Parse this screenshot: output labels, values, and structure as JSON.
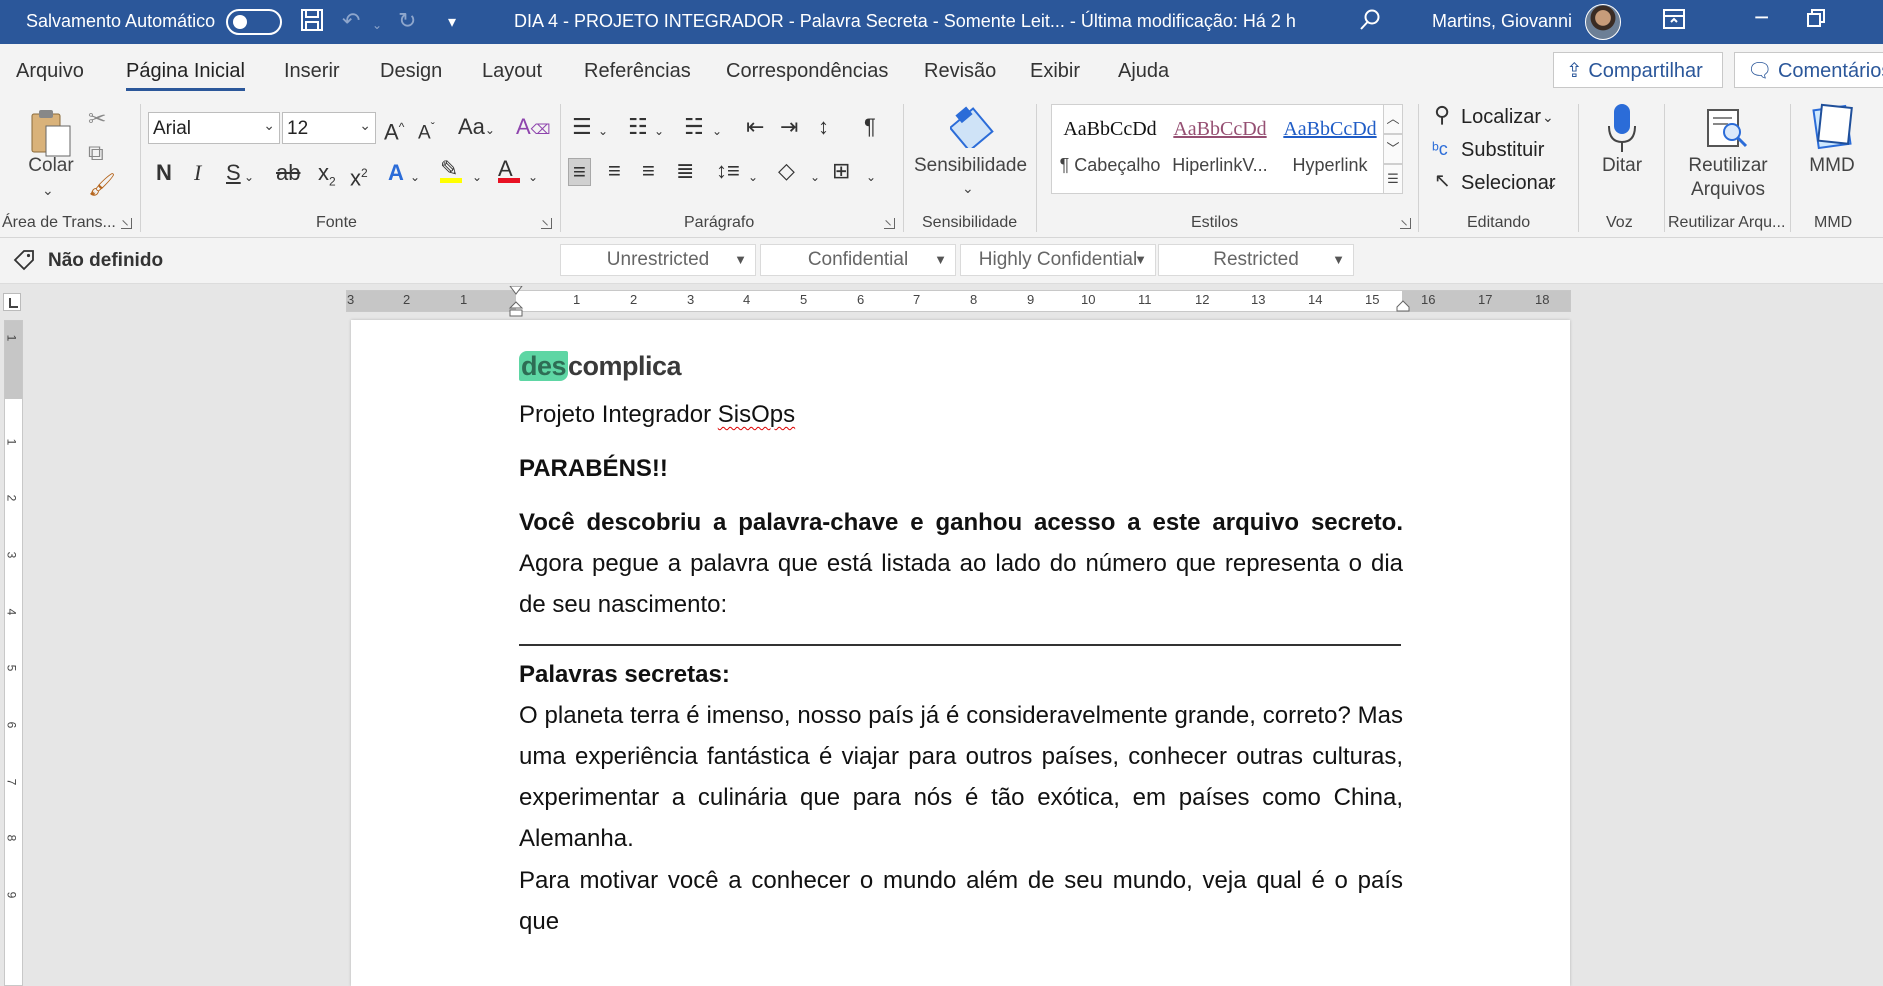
{
  "titlebar": {
    "autosave_label": "Salvamento Automático",
    "doc_title": "DIA 4 - PROJETO INTEGRADOR - Palavra Secreta  -  Somente Leit...  -  Última modificação: Há 2 h",
    "user_name": "Martins, Giovanni"
  },
  "tabs": [
    "Arquivo",
    "Página Inicial",
    "Inserir",
    "Design",
    "Layout",
    "Referências",
    "Correspondências",
    "Revisão",
    "Exibir",
    "Ajuda"
  ],
  "share": {
    "share_label": "Compartilhar",
    "comments_label": "Comentários"
  },
  "ribbon": {
    "clipboard": {
      "paste_label": "Colar",
      "group_label": "Área de Trans..."
    },
    "font": {
      "font_name": "Arial",
      "font_size": "12",
      "group_label": "Fonte"
    },
    "paragraph": {
      "group_label": "Parágrafo"
    },
    "sensitivity": {
      "button_label": "Sensibilidade",
      "group_label": "Sensibilidade"
    },
    "styles": {
      "items": [
        {
          "sample": "AaBbCcDd",
          "name": "¶ Cabeçalho"
        },
        {
          "sample": "AaBbCcDd",
          "name": "HiperlinkV..."
        },
        {
          "sample": "AaBbCcDd",
          "name": "Hyperlink"
        }
      ],
      "group_label": "Estilos"
    },
    "editing": {
      "find": "Localizar",
      "replace": "Substituir",
      "select": "Selecionar",
      "group_label": "Editando"
    },
    "voice": {
      "dictate": "Ditar",
      "group_label": "Voz"
    },
    "reuse": {
      "line1": "Reutilizar",
      "line2": "Arquivos",
      "group_label": "Reutilizar Arqu..."
    },
    "mmd": {
      "button": "MMD",
      "group_label": "MMD"
    }
  },
  "sensitivity_bar": {
    "status": "Não definido",
    "options": [
      "Unrestricted",
      "Confidential",
      "Highly Confidential",
      "Restricted"
    ]
  },
  "ruler": {
    "h_numbers": [
      "3",
      "2",
      "1",
      "1",
      "2",
      "3",
      "4",
      "5",
      "6",
      "7",
      "8",
      "9",
      "10",
      "11",
      "12",
      "13",
      "14",
      "15",
      "16",
      "17",
      "18"
    ],
    "v_numbers": [
      "1",
      "1",
      "2",
      "3",
      "4",
      "5",
      "6",
      "7",
      "8",
      "9"
    ]
  },
  "document": {
    "logo_part1": "des",
    "logo_part2": "complica",
    "title_prefix": "Projeto Integrador ",
    "title_misspelled": "SisOps",
    "congrats": "PARABÉNS!!",
    "discovered_bold": "Você descobriu a palavra-chave e ganhou acesso a este arquivo secreto.",
    "instruction": " Agora pegue a palavra que está listada ao lado do número que representa o dia de seu nascimento:",
    "secret_heading": "Palavras secretas:",
    "para1": "O planeta terra é imenso, nosso país já é consideravelmente grande, correto? Mas uma experiência fantástica é viajar para outros países, conhecer outras culturas, experimentar a culinária que para nós é tão exótica, em países como China, Alemanha.",
    "para2": "Para motivar você a conhecer o mundo além de seu mundo, veja qual é o país que"
  },
  "colors": {
    "title_bar": "#2b579a",
    "ribbon_bg": "#f3f3f3",
    "logo_green": "#5ed6a4",
    "hyperlink_blue": "#1f5cc6",
    "hyperlink_visited": "#954f72"
  }
}
